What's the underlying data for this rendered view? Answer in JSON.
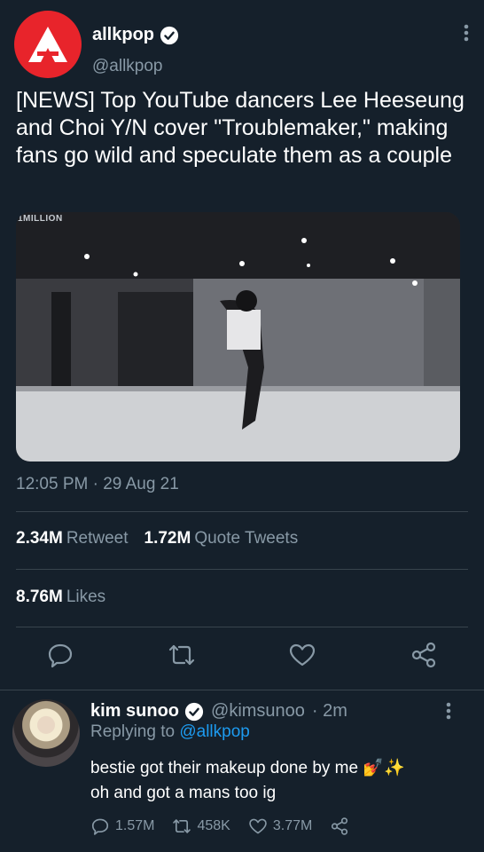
{
  "tweet": {
    "author_name": "allkpop",
    "author_handle": "@allkpop",
    "text": "[NEWS] Top YouTube dancers Lee Heeseung and Choi Y/N cover \"Troublemaker,\" making fans go wild and speculate them as a couple",
    "media_watermark": "1MILLION",
    "timestamp": "12:05 PM · 29 Aug 21",
    "retweets_count": "2.34M",
    "retweets_label": "Retweet",
    "quotes_count": "1.72M",
    "quotes_label": "Quote Tweets",
    "likes_count": "8.76M",
    "likes_label": "Likes",
    "brand_color": "#e8242b"
  },
  "reply": {
    "author_name": "kim sunoo",
    "author_handle": "@kimsunoo",
    "time": "· 2m",
    "replying_label": "Replying to",
    "replying_to": "@allkpop",
    "text_line1": "bestie got their makeup done by me 💅✨",
    "text_line2": "oh and got a mans too ig",
    "replies": "1.57M",
    "retweets": "458K",
    "likes": "3.77M"
  },
  "icons": [
    "verified-icon",
    "more-icon",
    "reply-icon",
    "retweet-icon",
    "like-icon",
    "share-icon"
  ],
  "colors": {
    "background": "#15202b",
    "muted": "#8899a6",
    "link": "#1d9bf0",
    "divider": "#38444d"
  }
}
